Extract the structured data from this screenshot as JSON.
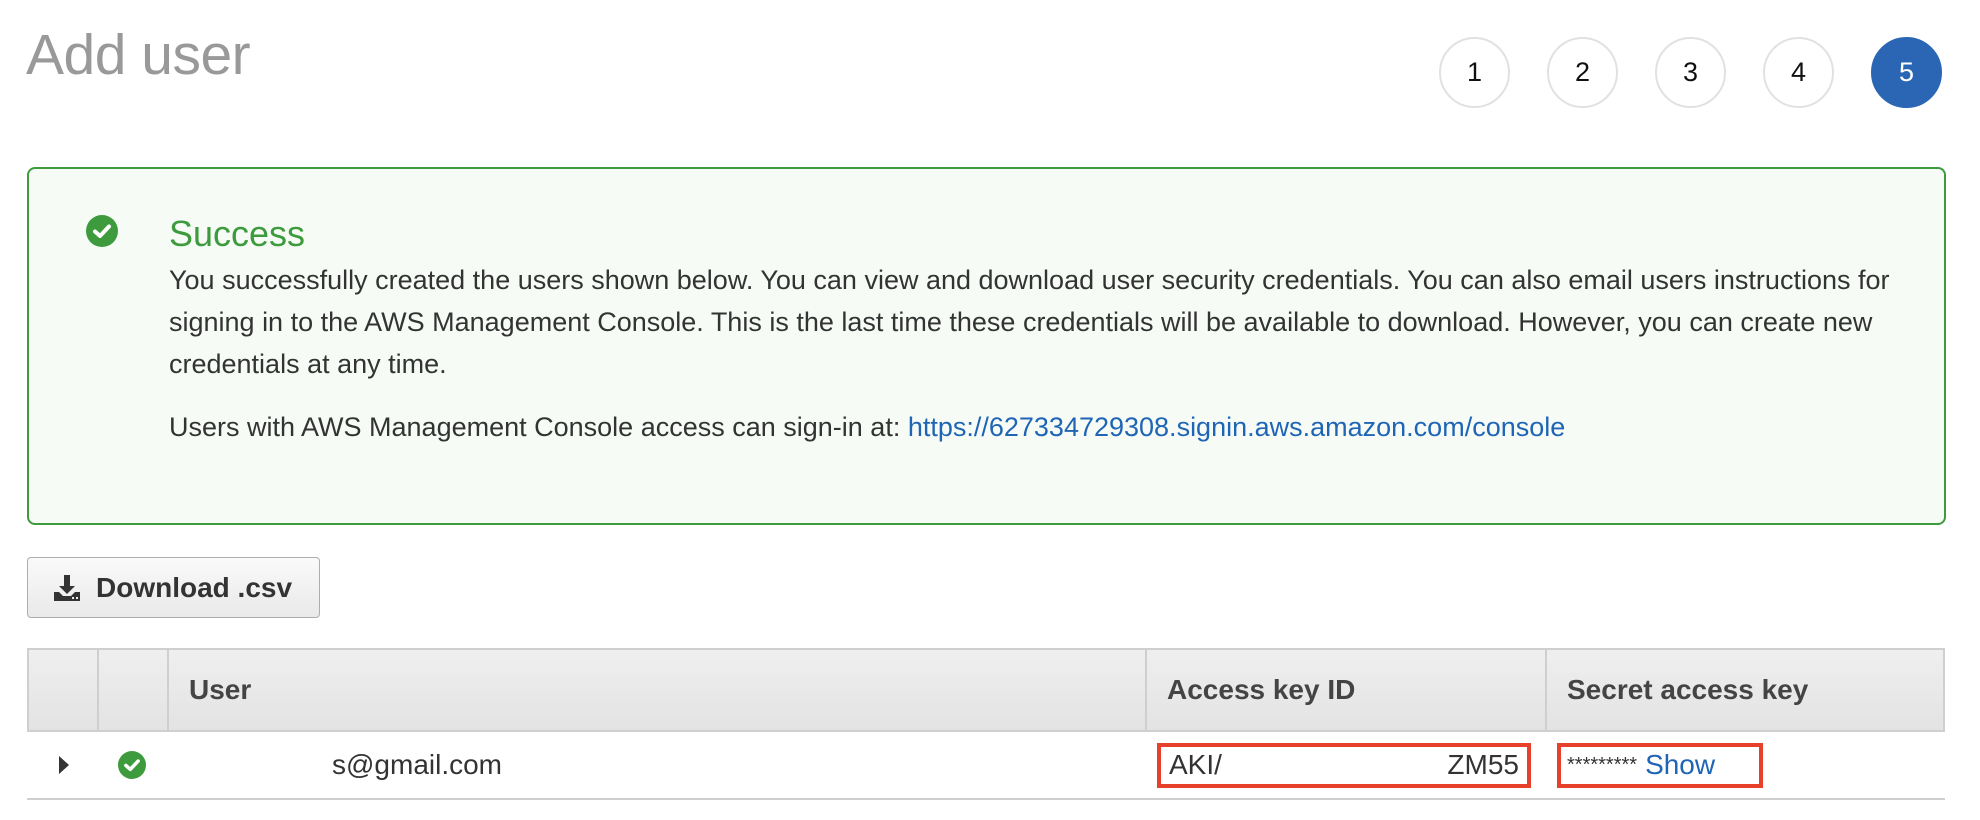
{
  "page": {
    "title": "Add user"
  },
  "stepper": {
    "steps": [
      "1",
      "2",
      "3",
      "4",
      "5"
    ],
    "active_step": "5",
    "active_color": "#2b66b5"
  },
  "alert": {
    "icon": "check-circle-icon",
    "title": "Success",
    "body": "You successfully created the users shown below. You can view and download user security credentials. You can also email users instructions for signing in to the AWS Management Console. This is the last time these credentials will be available to download. However, you can create new credentials at any time.",
    "signin_prefix": "Users with AWS Management Console access can sign-in at: ",
    "signin_url": "https://627334729308.signin.aws.amazon.com/console",
    "color": "#3d9b3d"
  },
  "toolbar": {
    "download_label": "Download .csv",
    "download_icon": "download-icon"
  },
  "table": {
    "columns": [
      "",
      "",
      "User",
      "Access key ID",
      "Secret access key"
    ],
    "rows": [
      {
        "expand_icon": "caret-right-icon",
        "status_icon": "check-circle-icon",
        "user": "s@gmail.com",
        "access_key_prefix": "AKI/",
        "access_key_suffix": "ZM55",
        "secret_masked": "*********",
        "secret_show_label": "Show"
      }
    ]
  },
  "annotations": {
    "highlight_color": "#e8412b"
  }
}
